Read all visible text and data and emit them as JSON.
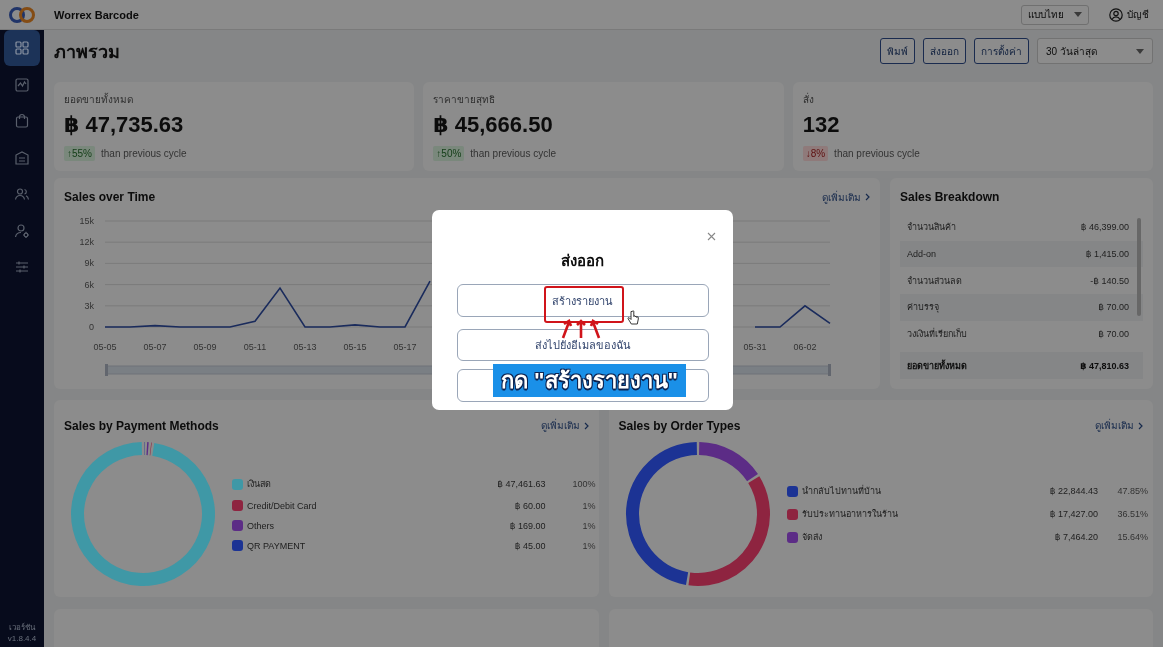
{
  "app": {
    "name": "Worrex Barcode"
  },
  "topbar": {
    "language": "แบบไทย",
    "account": "บัญชี"
  },
  "sidebar": {
    "items": [
      {
        "selected": true
      },
      {
        "selected": false
      },
      {
        "selected": false
      },
      {
        "selected": false
      },
      {
        "selected": false
      },
      {
        "selected": false
      },
      {
        "selected": false
      }
    ],
    "version_label": "เวอร์ชัน",
    "version": "v1.8.4.4"
  },
  "page": {
    "title": "ภาพรวม",
    "buttons": [
      "พิมพ์",
      "ส่งออก",
      "การตั้งค่า"
    ],
    "period": "30 วันล่าสุด"
  },
  "stats": [
    {
      "label": "ยอดขายทั้งหมด",
      "value": "฿ 47,735.63",
      "change": "↑55%",
      "rising": true,
      "note": "than previous cycle"
    },
    {
      "label": "ราคาขายสุทธิ",
      "value": "฿ 45,666.50",
      "change": "↑50%",
      "rising": true,
      "note": "than previous cycle"
    },
    {
      "label": "สั่ง",
      "value": "132",
      "change": "↓8%",
      "rising": false,
      "note": "than previous cycle"
    }
  ],
  "sales_over_time": {
    "title": "Sales over Time",
    "link": "ดูเพิ่มเติม",
    "chart_data": {
      "type": "line",
      "categories": [
        "05-05",
        null,
        "05-07",
        null,
        "05-09",
        null,
        "05-11",
        null,
        "05-13",
        null,
        "05-15",
        null,
        "05-17",
        null,
        null,
        null,
        null,
        null,
        null,
        null,
        null,
        null,
        null,
        null,
        null,
        null,
        "05-31",
        null,
        "06-02",
        null
      ],
      "series": [
        {
          "color": "#1a2b5c",
          "values": [
            0,
            0,
            200,
            0,
            0,
            0,
            800,
            5500,
            0,
            0,
            300,
            0,
            0,
            6500,
            null,
            null,
            null,
            null,
            null,
            null,
            null,
            null,
            null,
            null,
            null,
            null,
            0,
            0,
            3000,
            500
          ]
        }
      ],
      "ylim": [
        0,
        15000
      ],
      "grid": true,
      "yticks": [
        {
          "value": 0,
          "label": "0"
        },
        {
          "value": 3000,
          "label": "3k"
        },
        {
          "value": 6000,
          "label": "6k"
        },
        {
          "value": 9000,
          "label": "9k"
        },
        {
          "value": 12000,
          "label": "12k"
        },
        {
          "value": 15000,
          "label": "15k"
        }
      ]
    }
  },
  "sales_breakdown": {
    "title": "Sales Breakdown",
    "rows": [
      {
        "label": "จำนวนสินค้า",
        "amount": "฿ 46,399.00"
      },
      {
        "label": "Add-on",
        "amount": "฿ 1,415.00"
      },
      {
        "label": "จำนวนส่วนลด",
        "amount": "-฿ 140.50"
      },
      {
        "label": "ค่าบรรจุ",
        "amount": "฿ 70.00"
      },
      {
        "label": "วงเงินที่เรียกเก็บ",
        "amount": "฿ 70.00"
      }
    ],
    "total": {
      "label": "ยอดขายทั้งหมด",
      "amount": "฿ 47,810.63"
    }
  },
  "payment_methods": {
    "title": "Sales by Payment Methods",
    "link": "ดูเพิ่มเติม",
    "items": [
      {
        "amount": "฿ 47,461.63",
        "percent": "100%",
        "color": "#3f98a6"
      },
      {
        "amount": "฿ 60.00",
        "percent": "1%",
        "color": "#8e2440"
      },
      {
        "amount": "฿ 169.00",
        "percent": "1%",
        "color": "#5c2c86"
      },
      {
        "amount": "฿ 45.00",
        "percent": "1%",
        "color": "#1c3394"
      }
    ],
    "chart_data": {
      "type": "donut",
      "categories": [
        "เงินสด",
        "Credit/Debit Card",
        "Others",
        "QR PAYMENT"
      ],
      "values": [
        99.43,
        0.13,
        0.35,
        0.09
      ]
    }
  },
  "order_types": {
    "title": "Sales by Order Types",
    "link": "ดูเพิ่มเติม",
    "items": [
      {
        "amount": "฿ 22,844.43",
        "percent": "47.85%",
        "color": "#1c3394"
      },
      {
        "amount": "฿ 17,427.00",
        "percent": "36.51%",
        "color": "#8e2440"
      },
      {
        "amount": "฿ 7,464.20",
        "percent": "15.64%",
        "color": "#5c2c86"
      }
    ],
    "chart_data": {
      "type": "donut",
      "categories": [
        "นำกลับไปทานที่บ้าน",
        "รับประทานอาหารในร้าน",
        "จัดส่ง"
      ],
      "values": [
        47.85,
        36.51,
        15.64
      ]
    }
  },
  "modal": {
    "title": "ส่งออก",
    "options": [
      {
        "kind": "labelled",
        "label": "สร้างรายงาน"
      },
      {
        "kind": "labelled",
        "label": "ส่งไปยังอีเมลของฉัน"
      },
      {
        "kind": "covered"
      }
    ]
  },
  "annotation": {
    "text": "กด \"สร้างรายงาน\""
  }
}
